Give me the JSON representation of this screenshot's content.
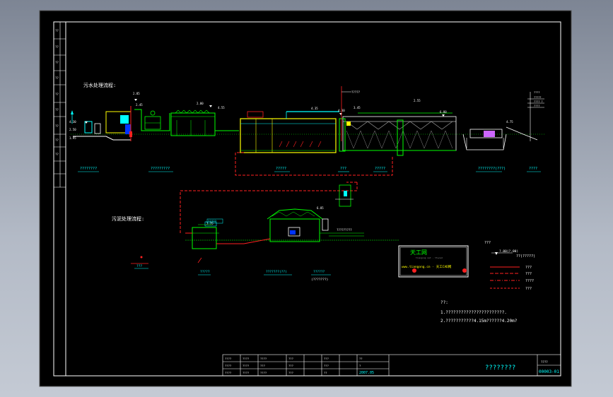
{
  "sewage_title": "污水处理流程:",
  "sludge_title": "污泥处理流程:",
  "header_level": "0.00",
  "tick_labels": {
    "top_left": [
      "4.30",
      "2.50",
      "1.95"
    ],
    "grit": [
      "2.85",
      "2.45"
    ],
    "aeration": [
      "2.00",
      "4.55"
    ],
    "pipe_rack": [
      "4.35"
    ],
    "secondary": [
      "4.30",
      "3.45",
      "2.55"
    ],
    "outfall": [
      "6.80",
      "4.75"
    ],
    "sludge": [
      "2.75",
      "6.85"
    ]
  },
  "unit_labels": [
    "????????",
    "?????????",
    "?????",
    "???",
    "?????",
    "????????(???)",
    "????"
  ],
  "top_marker": "?????",
  "sludge_unit_labels": [
    "???",
    "?????",
    "???????(??)",
    "??????"
  ],
  "sludge_sub_label": "(???????)",
  "sludge_note": "?????????",
  "sludge_tag": "?????",
  "logo_main": "天工网",
  "logo_sub": "tiangong net · ttwcad",
  "logo_url": "www.tiangong.cn · 天工CAD网",
  "legend": {
    "title": "???",
    "header": "?.00(?.00)",
    "header_note": "??(?????)",
    "items": [
      "???",
      "???",
      "????",
      "???"
    ]
  },
  "notes": {
    "title": "??:",
    "lines": [
      "1.???????????????????????.",
      "2.???????????4.15m??????4.20m?"
    ]
  },
  "title_block": {
    "rows": [
      [
        "????",
        "????",
        "????",
        "???",
        "???",
        "??"
      ],
      [
        "????",
        "????",
        "???",
        "???",
        "???",
        "?"
      ],
      [
        "????",
        "????",
        "????",
        "???",
        "??",
        "2007.05"
      ]
    ],
    "drawing_title": "????????",
    "drawing_no": "00003-01",
    "sheet": "????"
  },
  "colors": {
    "paper": "#000000",
    "frame": "#ffffff",
    "structure": "#00ff00",
    "process": "#ffff00",
    "sludge_line": "#ff2020",
    "water": "#00ffff",
    "membrane": "#cc66ff"
  }
}
